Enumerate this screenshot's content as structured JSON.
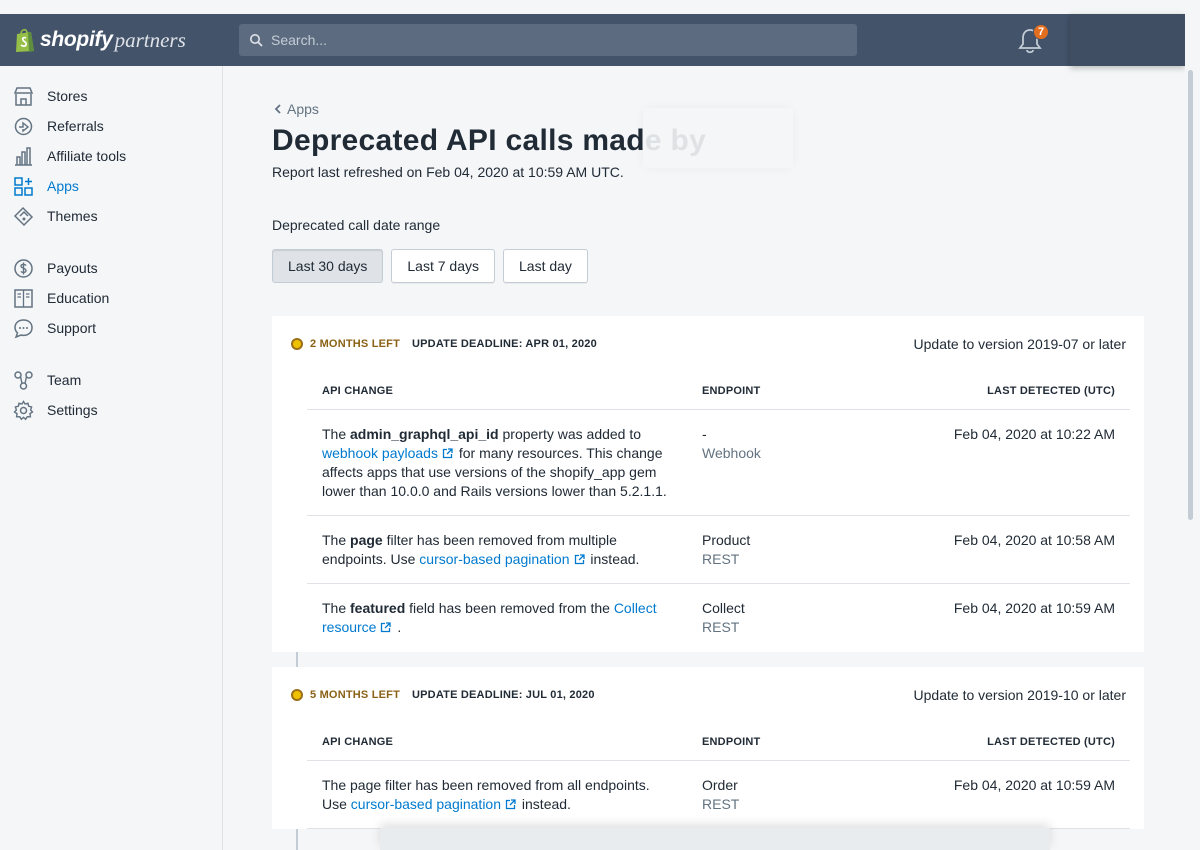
{
  "topbar": {
    "brand_main": "shopify",
    "brand_sub": "partners",
    "search_placeholder": "Search...",
    "notification_count": "7"
  },
  "sidebar": {
    "groups": [
      [
        {
          "label": "Stores",
          "icon": "store-icon"
        },
        {
          "label": "Referrals",
          "icon": "referrals-icon"
        },
        {
          "label": "Affiliate tools",
          "icon": "analytics-icon"
        },
        {
          "label": "Apps",
          "icon": "apps-icon",
          "active": true
        },
        {
          "label": "Themes",
          "icon": "themes-icon"
        }
      ],
      [
        {
          "label": "Payouts",
          "icon": "dollar-icon"
        },
        {
          "label": "Education",
          "icon": "book-icon"
        },
        {
          "label": "Support",
          "icon": "chat-icon"
        }
      ],
      [
        {
          "label": "Team",
          "icon": "team-icon"
        },
        {
          "label": "Settings",
          "icon": "gear-icon"
        }
      ]
    ]
  },
  "page": {
    "breadcrumb": "Apps",
    "title": "Deprecated API calls made by",
    "refreshed": "Report last refreshed on Feb 04, 2020 at 10:59 AM UTC.",
    "range_label": "Deprecated call date range",
    "range_buttons": [
      "Last 30 days",
      "Last 7 days",
      "Last day"
    ],
    "selected_range": "Last 30 days"
  },
  "table_headers": {
    "api_change": "API CHANGE",
    "endpoint": "ENDPOINT",
    "last_detected": "LAST DETECTED (UTC)"
  },
  "sections": [
    {
      "months_left": "2 MONTHS LEFT",
      "deadline": "UPDATE DEADLINE: APR 01, 2020",
      "update_to": "Update to version 2019-07 or later",
      "rows": [
        {
          "change_pre": "The ",
          "change_bold": "admin_graphql_api_id",
          "change_mid": " property was added to ",
          "change_link": "webhook payloads",
          "change_post": " for many resources. This change affects apps that use versions of the shopify_app gem lower than 10.0.0 and Rails versions lower than 5.2.1.1.",
          "endpoint_name": "-",
          "endpoint_type": "Webhook",
          "detected": "Feb 04, 2020 at 10:22 AM"
        },
        {
          "change_pre": "The ",
          "change_bold": "page",
          "change_mid": " filter has been removed from multiple endpoints. Use ",
          "change_link": "cursor-based pagination",
          "change_post": " instead.",
          "endpoint_name": "Product",
          "endpoint_type": "REST",
          "detected": "Feb 04, 2020 at 10:58 AM"
        },
        {
          "change_pre": "The ",
          "change_bold": "featured",
          "change_mid": " field has been removed from the ",
          "change_link": "Collect resource",
          "change_post": " .",
          "endpoint_name": "Collect",
          "endpoint_type": "REST",
          "detected": "Feb 04, 2020 at 10:59 AM"
        }
      ]
    },
    {
      "months_left": "5 MONTHS LEFT",
      "deadline": "UPDATE DEADLINE: JUL 01, 2020",
      "update_to": "Update to version 2019-10 or later",
      "rows": [
        {
          "change_pre": "The page filter has been removed from all endpoints. Use ",
          "change_bold": "",
          "change_mid": "",
          "change_link": "cursor-based pagination",
          "change_post": " instead.",
          "endpoint_name": "Order",
          "endpoint_type": "REST",
          "detected": "Feb 04, 2020 at 10:59 AM"
        }
      ]
    }
  ],
  "colors": {
    "topbar": "#43536a",
    "link": "#007ace",
    "warning_dot": "#eec200",
    "warning_text": "#8a6116"
  }
}
